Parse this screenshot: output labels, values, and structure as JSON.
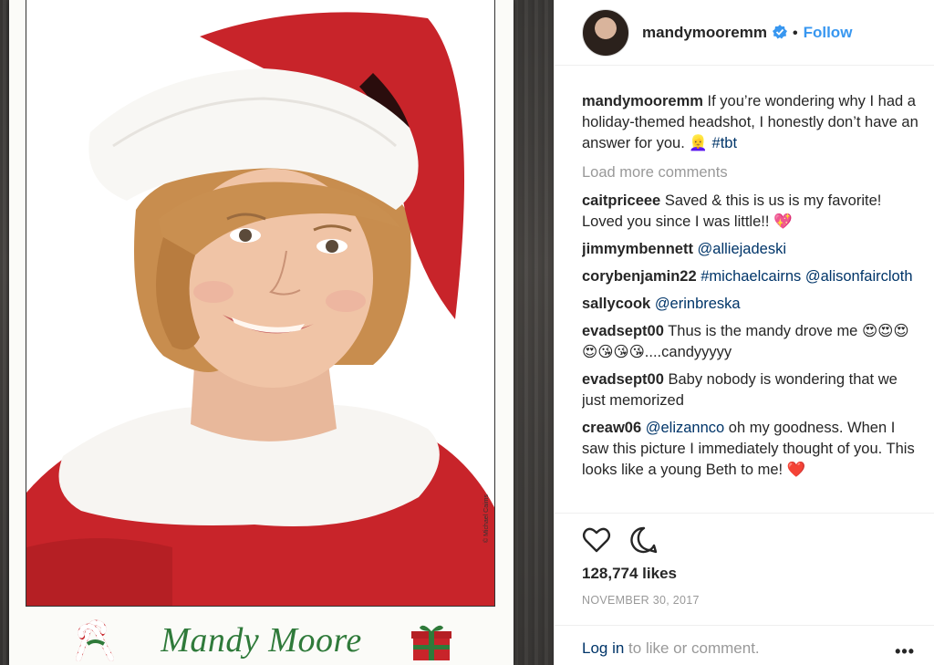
{
  "post": {
    "username": "mandymooremm",
    "follow_label": "Follow",
    "dot": "•",
    "caption_user": "mandymooremm",
    "caption_text": "If you’re wondering why I had a holiday-themed headshot, I honestly don’t have an answer for you. 👱‍♀️",
    "caption_tag": "#tbt",
    "load_more": "Load more comments",
    "likes": "128,774 likes",
    "date": "NOVEMBER 30, 2017",
    "login_link": "Log in",
    "login_rest": " to like or comment.",
    "more_label": "•••"
  },
  "comments": [
    {
      "user": "caitpriceee",
      "text": "Saved & this is us is my favorite! Loved you since I was little!! 💖",
      "mention": ""
    },
    {
      "user": "jimmymbennett",
      "text": "",
      "mention": "@alliejadeski"
    },
    {
      "user": "corybenjamin22",
      "text": "",
      "mention": "#michaelcairns @alisonfaircloth"
    },
    {
      "user": "sallycook",
      "text": "",
      "mention": "@erinbreska"
    },
    {
      "user": "evadsept00",
      "text": "Thus is the mandy drove me 😍😍😍😍😘😘😘....candyyyyy",
      "mention": ""
    },
    {
      "user": "evadsept00",
      "text": "Baby nobody is wondering that we just memorized",
      "mention": ""
    },
    {
      "user": "creaw06",
      "mention": "@elizannco",
      "text": " oh my goodness. When I saw this picture I immediately thought of you. This looks like a young Beth to me! ❤️"
    }
  ],
  "photo": {
    "name_text": "Mandy Moore",
    "credit": "© Michael Caims"
  },
  "icons": {
    "verified": "verified-badge-icon",
    "heart": "heart-icon",
    "comment": "comment-bubble-icon",
    "candy_cane": "candy-cane-icon",
    "gift": "gift-icon"
  },
  "colors": {
    "link_blue": "#3897f0",
    "mention_blue": "#003569",
    "meta_gray": "#999999",
    "hat_red": "#c8242a",
    "name_green": "#2f7a3a"
  }
}
